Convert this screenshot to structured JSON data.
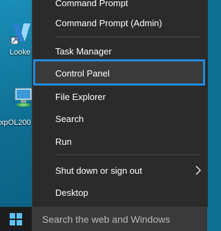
{
  "desktop": {
    "icons": [
      {
        "label": "Looke",
        "icon": "blue-shortcut-icon"
      },
      {
        "label": "xpOL200",
        "icon": "computer-icon"
      }
    ]
  },
  "menu": {
    "items": [
      {
        "label": "Command Prompt"
      },
      {
        "label": "Command Prompt (Admin)"
      },
      {
        "label": "Task Manager"
      },
      {
        "label": "Control Panel"
      },
      {
        "label": "File Explorer"
      },
      {
        "label": "Search"
      },
      {
        "label": "Run"
      },
      {
        "label": "Shut down or sign out"
      },
      {
        "label": "Desktop"
      }
    ],
    "highlighted": "Control Panel",
    "highlight_color": "#1e8ee8",
    "submenu_indicator": "chevron-right-icon"
  },
  "taskbar": {
    "start_icon": "windows-logo-icon",
    "search_placeholder": "Search the web and Windows"
  }
}
